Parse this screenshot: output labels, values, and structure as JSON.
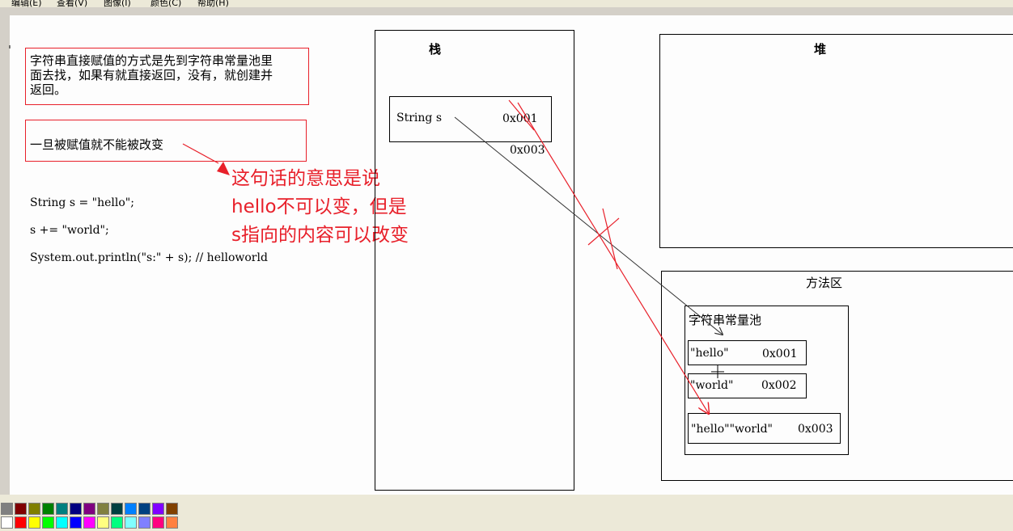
{
  "menu": {
    "edit": "编辑(E)",
    "view": "查看(V)",
    "image": "图像(I)",
    "colors": "颜色(C)",
    "help": "帮助(H)"
  },
  "notes": {
    "string_assign": [
      "字符串直接赋值的方式是先到字符串常量池里",
      "面去找，如果有就直接返回，没有，就创建并",
      "返回。"
    ],
    "immutable": "一旦被赋值就不能被改变",
    "annotation": [
      "这句话的意思是说",
      "hello不可以变，但是",
      "s指向的内容可以改变"
    ]
  },
  "code": {
    "line1": "String s = \"hello\";",
    "line2": "s += \"world\";",
    "line3": "System.out.println(\"s:\" + s); // helloworld"
  },
  "stack": {
    "title": "栈",
    "var_label": "String s",
    "old_addr": "0x001",
    "new_addr": "0x003"
  },
  "heap": {
    "title": "堆"
  },
  "method_area": {
    "title": "方法区",
    "pool_title": "字符串常量池",
    "entries": [
      {
        "value": "\"hello\"",
        "addr": "0x001"
      },
      {
        "value": "\"world\"",
        "addr": "0x002"
      },
      {
        "value": "\"hello\"\"world\"",
        "addr": "0x003"
      }
    ]
  },
  "palette": {
    "row1": [
      "#808080",
      "#800000",
      "#808000",
      "#008000",
      "#008080",
      "#000080",
      "#800080",
      "#808040",
      "#004040",
      "#0080ff",
      "#004080",
      "#8000ff",
      "#804000"
    ],
    "row2": [
      "#ffffff",
      "#ff0000",
      "#ffff00",
      "#00ff00",
      "#00ffff",
      "#0000ff",
      "#ff00ff",
      "#ffff80",
      "#00ff80",
      "#80ffff",
      "#8080ff",
      "#ff0080",
      "#ff8040"
    ]
  },
  "colors": {
    "accent_red": "#e8202a",
    "line_black": "#333333"
  }
}
